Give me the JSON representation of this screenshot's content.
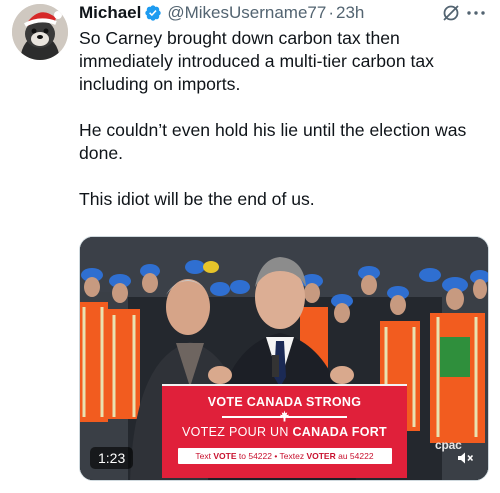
{
  "tweet": {
    "author_name": "Michael",
    "handle": "@MikesUsername77",
    "separator": "·",
    "time": "23h",
    "text": [
      "So Carney brought down carbon tax then immediately introduced a multi-tier carbon tax including on imports.",
      "He couldn’t even hold his lie until the election was done.",
      "This idiot will be the end of us."
    ],
    "verified_icon": "verified-badge-icon",
    "header_icons": [
      "grok-icon",
      "more-icon"
    ]
  },
  "video": {
    "duration": "1:23",
    "podium": {
      "line1": "VOTE CANADA STRONG",
      "line2_prefix": "VOTEZ POUR UN ",
      "line2_bold": "CANADA FORT",
      "sms_text1": "Text ",
      "sms_vote": "VOTE",
      "sms_text2": " to 54222 • Textez ",
      "sms_voter": "VOTER",
      "sms_text3": " au 54222"
    },
    "watermark": "cpac",
    "mute_icon": "speaker-muted-icon",
    "colors": {
      "podium_red": "#e0203a",
      "hardhat_blue": "#2f6fd1",
      "vest_orange": "#f25c1f"
    }
  },
  "colors": {
    "text": "#0f1419",
    "secondary": "#536471",
    "verified_blue": "#1d9bf0"
  }
}
